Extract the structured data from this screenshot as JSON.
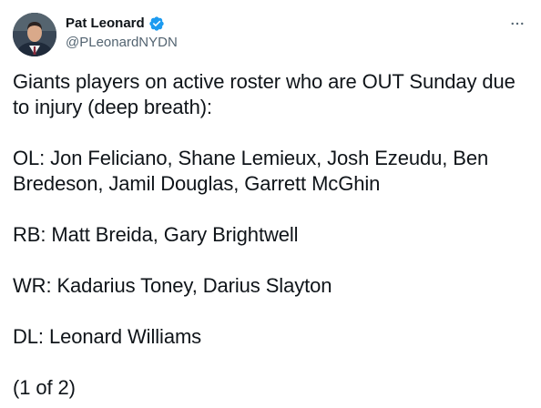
{
  "author": {
    "display_name": "Pat Leonard",
    "handle": "@PLeonardNYDN",
    "verified": true,
    "avatar_icon": "profile-photo",
    "verified_icon": "verified-badge-icon",
    "accent_color": "#1d9bf0"
  },
  "menu": {
    "icon": "more-options-icon"
  },
  "tweet": {
    "paragraphs": [
      "Giants players on active roster who are OUT Sunday due to injury (deep breath):",
      "OL: Jon Feliciano, Shane Lemieux, Josh Ezeudu, Ben Bredeson, Jamil Douglas, Garrett McGhin",
      "RB: Matt Breida, Gary Brightwell",
      "WR: Kadarius Toney, Darius Slayton",
      "DL: Leonard Williams",
      "(1 of 2)"
    ]
  }
}
